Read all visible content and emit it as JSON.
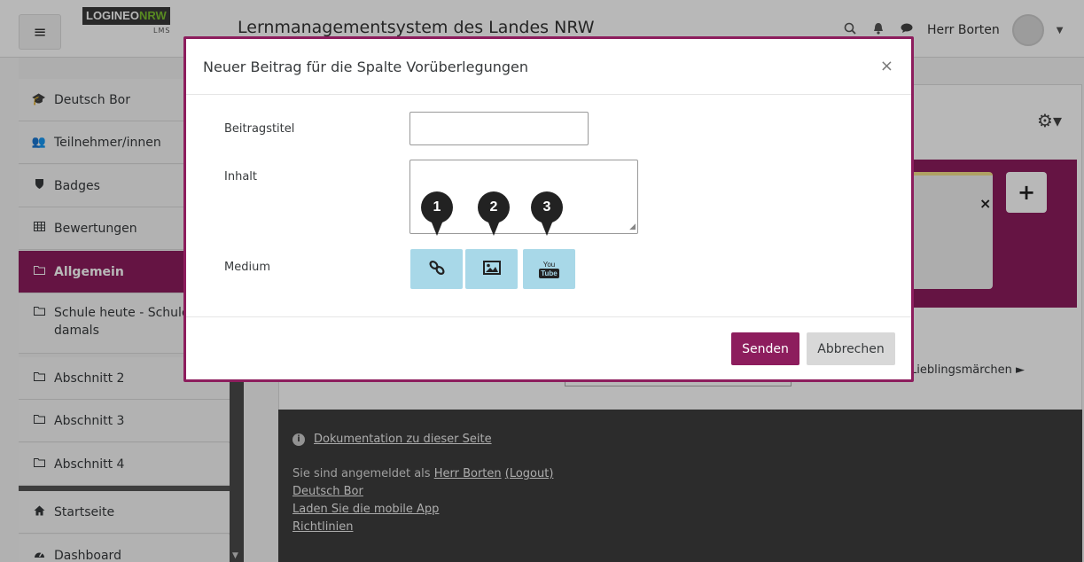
{
  "navbar": {
    "menu_icon": "hamburger-icon",
    "logo_text_a": "LOGINEO",
    "logo_text_b": "NRW",
    "logo_sub": "LMS",
    "site_name": "Lernmanagementsystem des Landes NRW",
    "icons": [
      "search-icon",
      "bell-icon",
      "chat-icon"
    ],
    "username": "Herr Borten"
  },
  "sidebar": {
    "items": [
      {
        "icon": "graduation-cap-icon",
        "label": "Deutsch Bor"
      },
      {
        "icon": "users-icon",
        "label": "Teilnehmer/innen"
      },
      {
        "icon": "shield-icon",
        "label": "Badges"
      },
      {
        "icon": "table-icon",
        "label": "Bewertungen"
      },
      {
        "icon": "folder-icon",
        "label": "Allgemein"
      },
      {
        "icon": "folder-icon",
        "label": "Schule heute - Schule damals"
      },
      {
        "icon": "folder-icon",
        "label": "Abschnitt 2"
      },
      {
        "icon": "folder-icon",
        "label": "Abschnitt 3"
      },
      {
        "icon": "folder-icon",
        "label": "Abschnitt 4"
      },
      {
        "icon": "home-icon",
        "label": "Startseite"
      },
      {
        "icon": "dashboard-icon",
        "label": "Dashboard"
      }
    ]
  },
  "main": {
    "next_link": "Lieblingsmärchen ►"
  },
  "footer": {
    "doc_link": "Dokumentation zu dieser Seite",
    "logged_in_prefix": "Sie sind angemeldet als ",
    "logged_in_user": "Herr Borten",
    "logout": "(Logout)",
    "course_link": "Deutsch Bor",
    "app_link": "Laden Sie die mobile App",
    "policies_link": "Richtlinien"
  },
  "modal": {
    "title": "Neuer Beitrag für die Spalte Vorüberlegungen",
    "close": "×",
    "fields": {
      "title_label": "Beitragstitel",
      "title_value": "",
      "content_label": "Inhalt",
      "content_value": "",
      "medium_label": "Medium"
    },
    "media_buttons": [
      {
        "icon": "link-icon",
        "marker": "1"
      },
      {
        "icon": "image-icon",
        "marker": "2"
      },
      {
        "icon": "youtube-icon",
        "marker": "3",
        "glyph_top": "You",
        "glyph_bottom": "Tube"
      }
    ],
    "send_label": "Senden",
    "cancel_label": "Abbrechen"
  },
  "colors": {
    "brand": "#8d1d5d",
    "media_button": "#a8d8e8",
    "footer_bg": "#3d3d3d"
  }
}
